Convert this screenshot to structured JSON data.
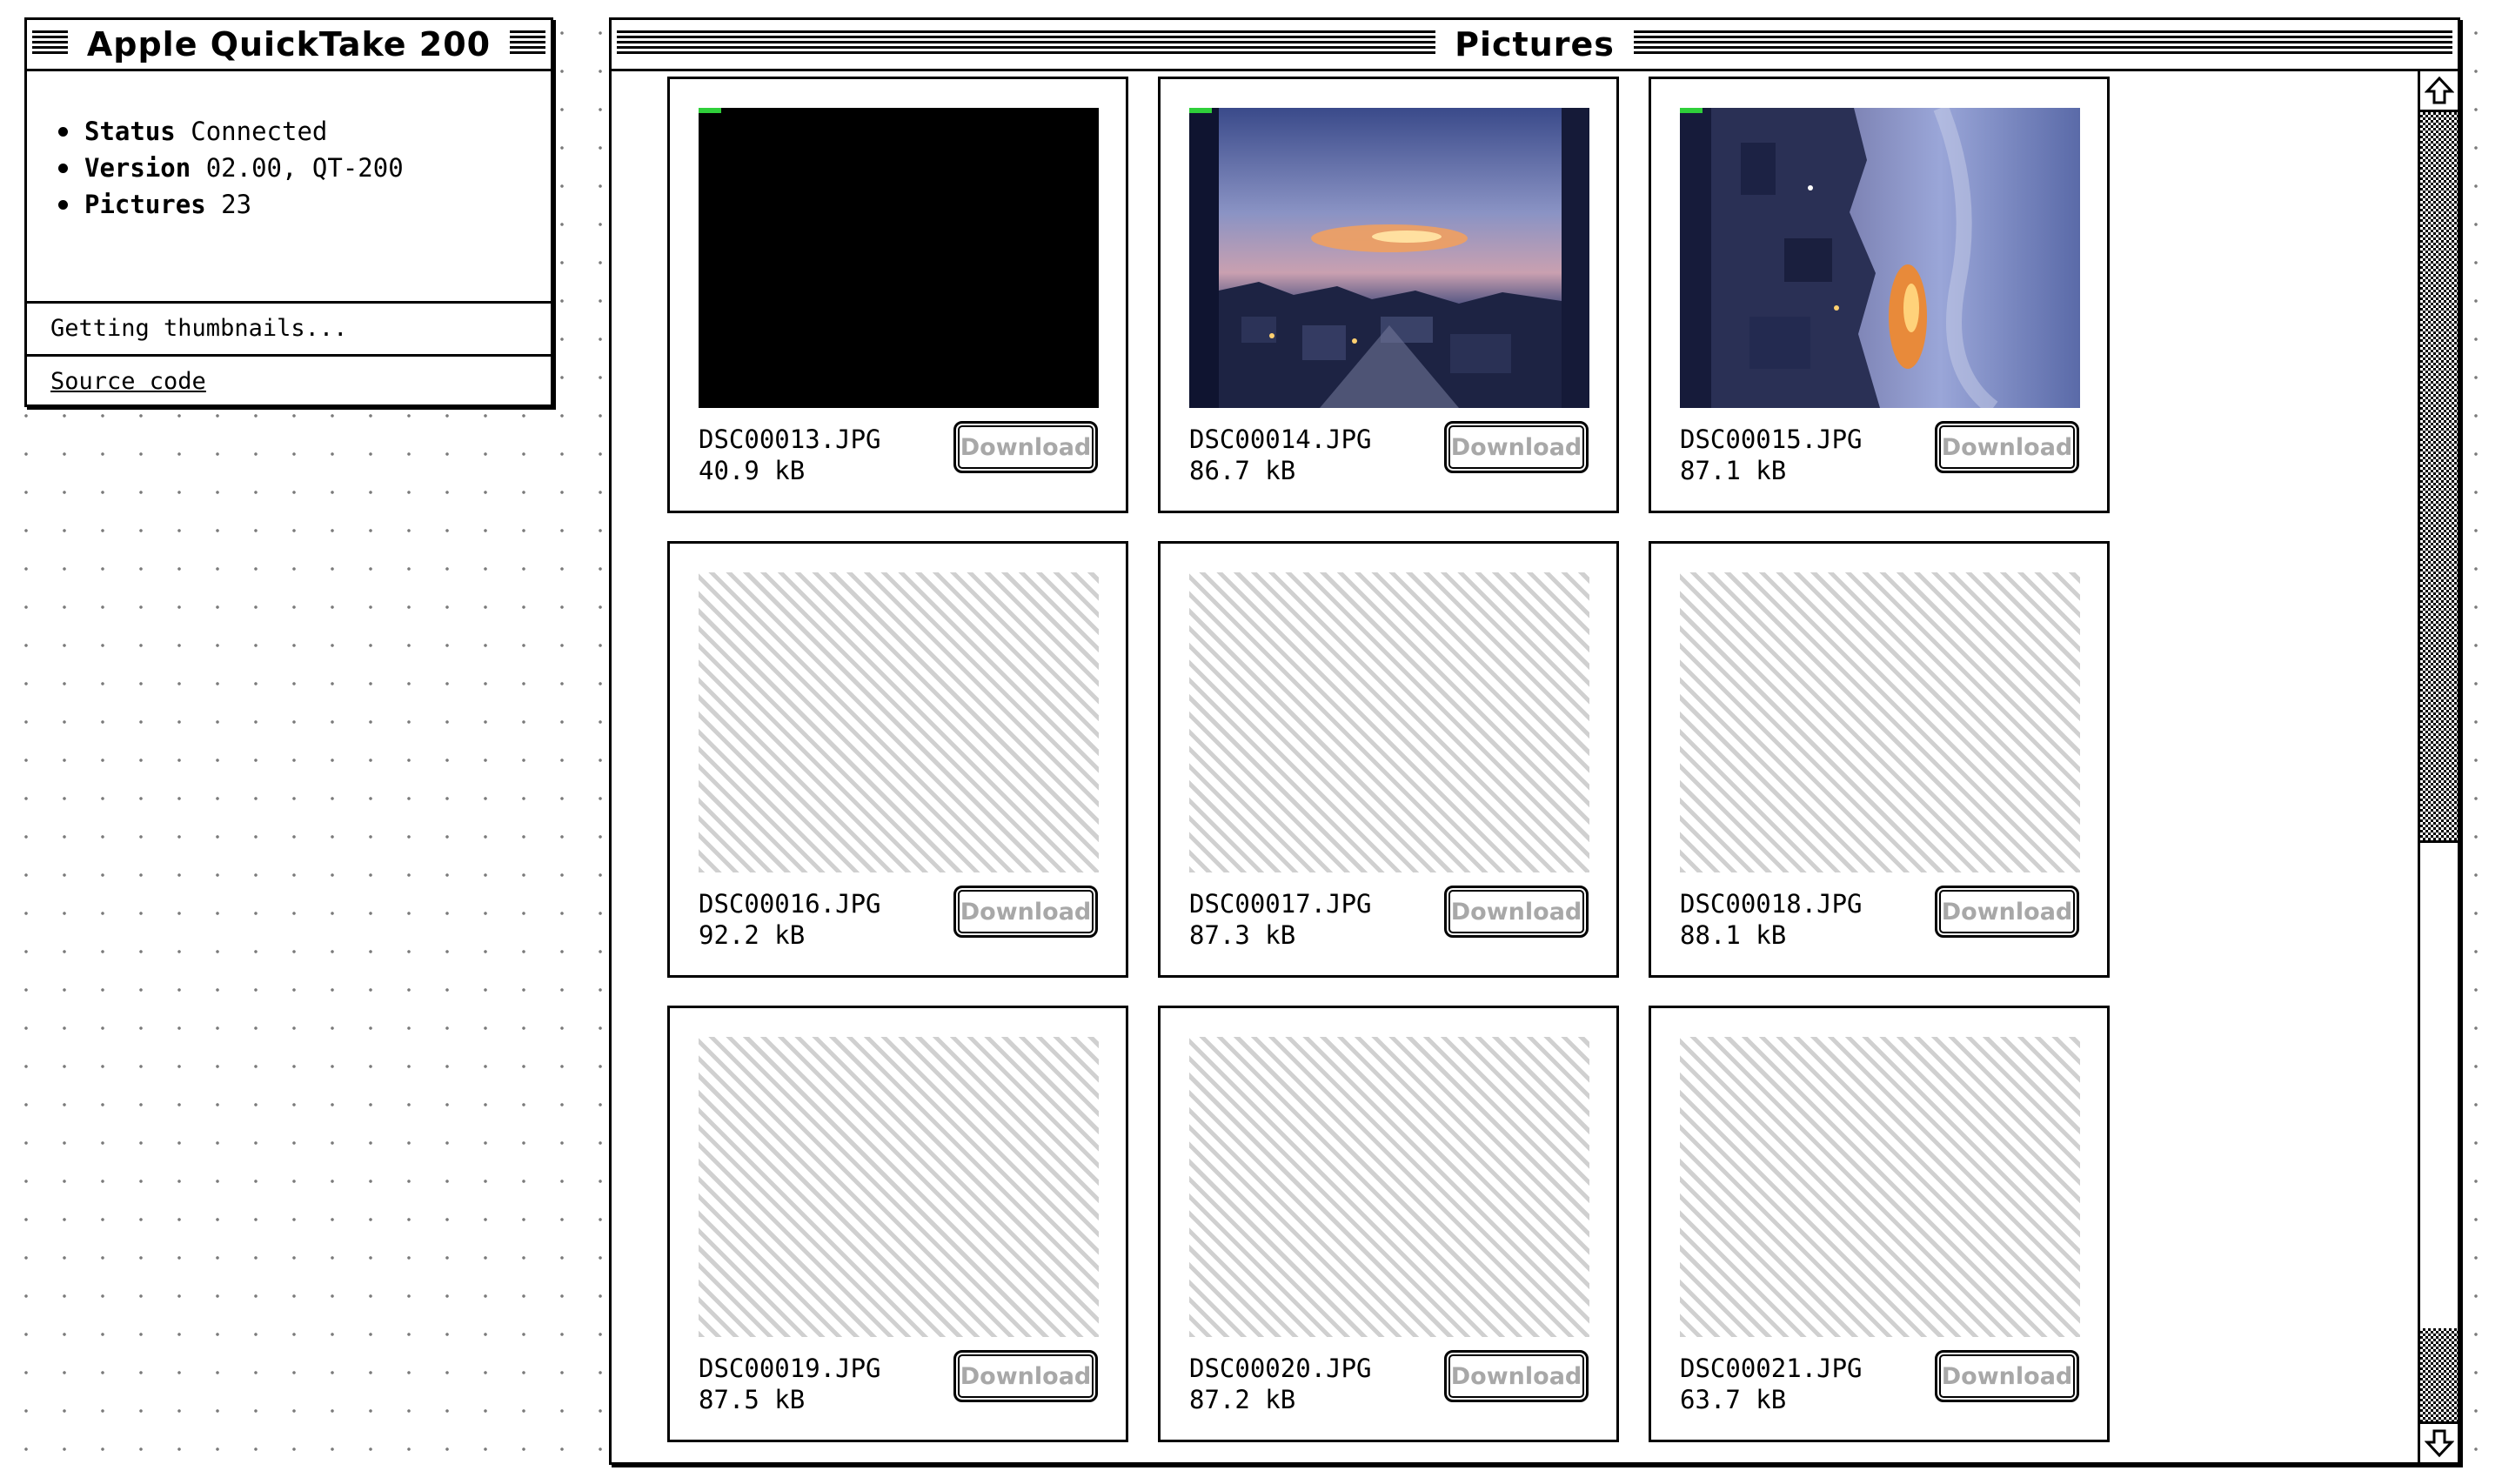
{
  "info_window": {
    "title": "Apple QuickTake 200",
    "details": [
      {
        "label": "Status",
        "value": "Connected"
      },
      {
        "label": "Version",
        "value": "02.00, QT-200"
      },
      {
        "label": "Pictures",
        "value": "23"
      }
    ],
    "progress_text": "Getting thumbnails...",
    "source_link": "Source code"
  },
  "pictures_window": {
    "title": "Pictures",
    "download_label": "Download",
    "pictures": [
      {
        "filename": "DSC00013.JPG",
        "size": "40.9 kB",
        "thumbnail": "dark"
      },
      {
        "filename": "DSC00014.JPG",
        "size": "86.7 kB",
        "thumbnail": "sunset-town"
      },
      {
        "filename": "DSC00015.JPG",
        "size": "87.1 kB",
        "thumbnail": "sunset-rotated"
      },
      {
        "filename": "DSC00016.JPG",
        "size": "92.2 kB",
        "thumbnail": "loading"
      },
      {
        "filename": "DSC00017.JPG",
        "size": "87.3 kB",
        "thumbnail": "loading"
      },
      {
        "filename": "DSC00018.JPG",
        "size": "88.1 kB",
        "thumbnail": "loading"
      },
      {
        "filename": "DSC00019.JPG",
        "size": "87.5 kB",
        "thumbnail": "loading"
      },
      {
        "filename": "DSC00020.JPG",
        "size": "87.2 kB",
        "thumbnail": "loading"
      },
      {
        "filename": "DSC00021.JPG",
        "size": "63.7 kB",
        "thumbnail": "loading"
      }
    ]
  },
  "colors": {
    "progress_accent": "#2fcf3a",
    "disabled_text": "#a8a8a8"
  }
}
